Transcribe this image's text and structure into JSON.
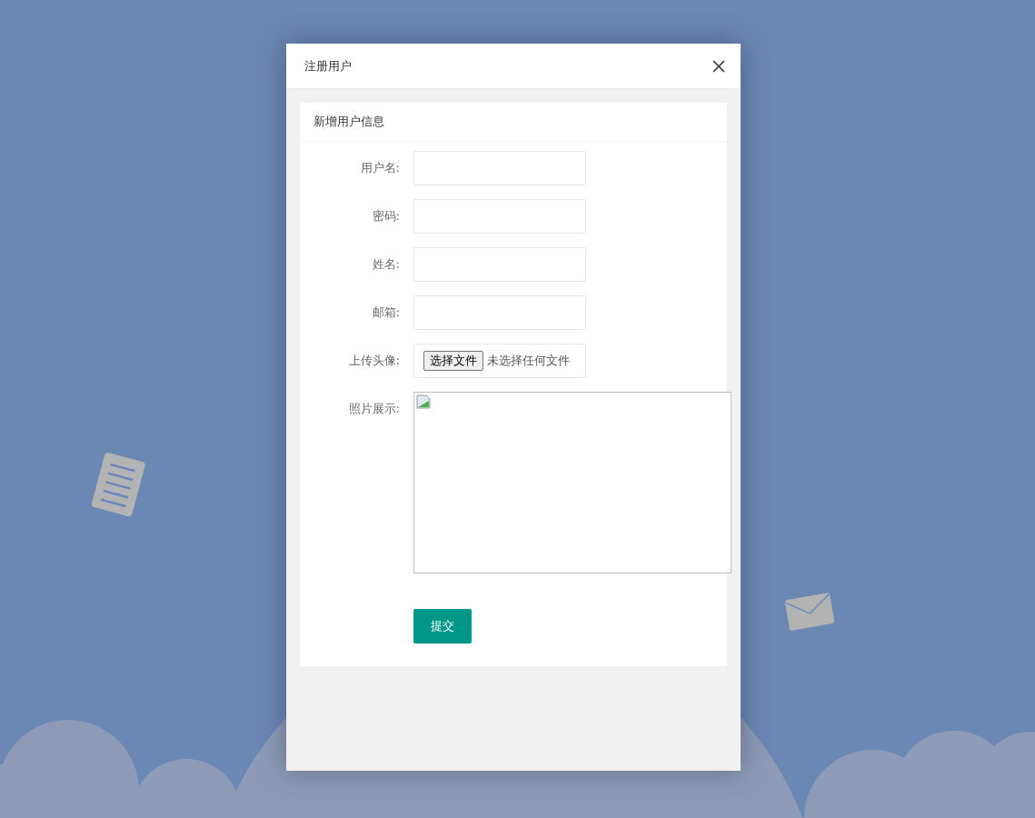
{
  "dialog": {
    "title": "注册用户"
  },
  "form": {
    "title": "新增用户信息",
    "fields": [
      {
        "kind": "text",
        "label": "用户名:"
      },
      {
        "kind": "text",
        "label": "密码:"
      },
      {
        "kind": "text",
        "label": "姓名:"
      },
      {
        "kind": "text",
        "label": "邮箱:"
      },
      {
        "kind": "file",
        "label": "上传头像:",
        "button": "选择文件",
        "status": "未选择任何文件"
      },
      {
        "kind": "image",
        "label": "照片展示:"
      }
    ],
    "submit": "提交"
  }
}
